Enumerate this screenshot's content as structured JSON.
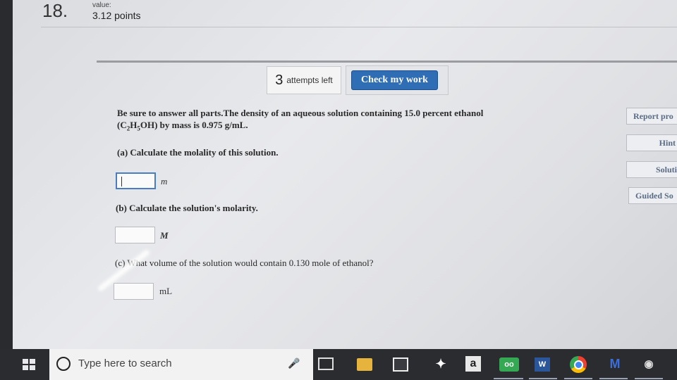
{
  "header": {
    "question_number": "18.",
    "value_label": "value:",
    "points": "3.12 points"
  },
  "toolbar": {
    "attempts_count": "3",
    "attempts_label": "attempts left",
    "check_button": "Check my work"
  },
  "question": {
    "prompt_line1": "Be sure to answer all parts.The density of an aqueous solution containing 15.0 percent ethanol",
    "formula_open": "(C",
    "formula_sub1": "2",
    "formula_mid": "H",
    "formula_sub2": "5",
    "formula_close": "OH) by mass is 0.975 g/mL.",
    "parts": [
      {
        "label": "(a) Calculate the molality of this solution.",
        "unit": "m",
        "value": ""
      },
      {
        "label": "(b) Calculate the solution's molarity.",
        "unit": "M",
        "value": ""
      },
      {
        "label": "(c) What volume of the solution would contain 0.130 mole of ethanol?",
        "unit": "mL",
        "value": ""
      }
    ]
  },
  "side_buttons": [
    "Report pro",
    "Hint",
    "Soluti",
    "Guided So"
  ],
  "taskbar": {
    "search_placeholder": "Type here to search",
    "icons": [
      "windows-start-icon",
      "cortana-icon",
      "microphone-icon",
      "task-view-icon",
      "file-explorer-icon",
      "store-icon",
      "dropbox-icon",
      "amazon-icon",
      "tripadvisor-icon",
      "word-icon",
      "chrome-icon",
      "m-app-icon",
      "steam-icon"
    ],
    "amazon_glyph": "a",
    "tripadvisor_glyph": "oo",
    "word_glyph": "W",
    "m_glyph": "M"
  }
}
